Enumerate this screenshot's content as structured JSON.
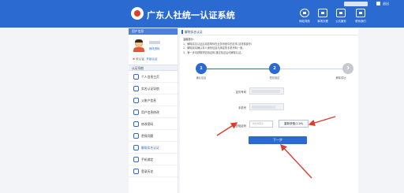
{
  "header": {
    "site_title": "广东人社统一认证系统",
    "logout": "退出",
    "nav": [
      {
        "label": "网站导航",
        "icon": "home-icon"
      },
      {
        "label": "事项办理",
        "icon": "document-icon"
      },
      {
        "label": "公共服务",
        "icon": "list-icon"
      },
      {
        "label": "联系我们",
        "icon": "contact-icon"
      }
    ]
  },
  "sidebar": {
    "user_section_title": "用户信息",
    "profile_link": "修改资料",
    "cert_mark": "✖",
    "cert_status": "未认证,",
    "cert_action": "开始认证",
    "nav_title": "认证导航",
    "menu": [
      {
        "label": "个人信息主页"
      },
      {
        "label": "实名认证导航"
      },
      {
        "label": "父账户信息"
      },
      {
        "label": "用户信息修改"
      },
      {
        "label": "修改密码"
      },
      {
        "label": "密保问题"
      },
      {
        "label": "解绑实名认证"
      },
      {
        "label": "手机绑定"
      },
      {
        "label": "登录历史"
      }
    ]
  },
  "main": {
    "title": "解除实名认证",
    "notice": {
      "title": "温馨提示:",
      "lines": [
        "1、解除实名认证后将影响你在业务系统中的办事,请谨慎操作!",
        "2、解除前请确认本人身份信息与绑定的手机号码一致。",
        "3、第一步请获取短信验证码,通过验证后可解除认证。"
      ]
    },
    "steps": [
      {
        "number": "1",
        "label": "确认信息",
        "done": true
      },
      {
        "number": "2",
        "label": "短信验证",
        "done": true
      },
      {
        "number": "3",
        "label": "解除成功",
        "done": false
      }
    ],
    "form": {
      "id_label": "证件号码",
      "phone_label": "手机号",
      "sms_label": "短信验证码",
      "sms_value": "045422",
      "sms_button": "重新获取(116)",
      "next_button": "下一步"
    }
  },
  "colors": {
    "header_bg": "#2b6ad0",
    "accent": "#2b6ad0",
    "annotation_arrow": "#e03a2e"
  }
}
